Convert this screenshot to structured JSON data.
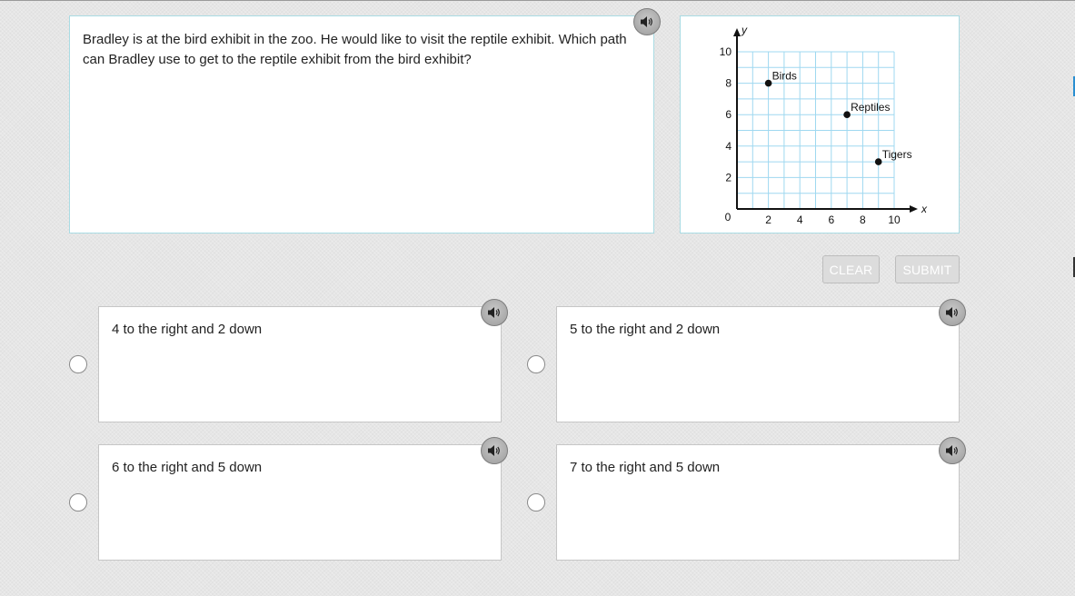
{
  "question": {
    "text": "Bradley is at the bird exhibit in the zoo. He would like to visit the reptile exhibit. Which path can Bradley use to get to the reptile exhibit from the bird exhibit?"
  },
  "graph": {
    "x_axis_label": "x",
    "y_axis_label": "y",
    "origin_label": "0",
    "x_ticks": [
      "2",
      "4",
      "6",
      "8",
      "10"
    ],
    "y_ticks": [
      "2",
      "4",
      "6",
      "8",
      "10"
    ],
    "points": [
      {
        "label": "Birds",
        "x": 2,
        "y": 8
      },
      {
        "label": "Reptiles",
        "x": 7,
        "y": 6
      },
      {
        "label": "Tigers",
        "x": 9,
        "y": 3
      }
    ],
    "grid_color": "#9fd8f0"
  },
  "toolbar": {
    "clear_label": "CLEAR",
    "submit_label": "SUBMIT"
  },
  "choices": [
    {
      "text": "4 to the right and 2 down"
    },
    {
      "text": "5 to the right and 2 down"
    },
    {
      "text": "6 to the right and 5 down"
    },
    {
      "text": "7 to the right and 5 down"
    }
  ],
  "icons": {
    "audio": "speaker-icon"
  }
}
